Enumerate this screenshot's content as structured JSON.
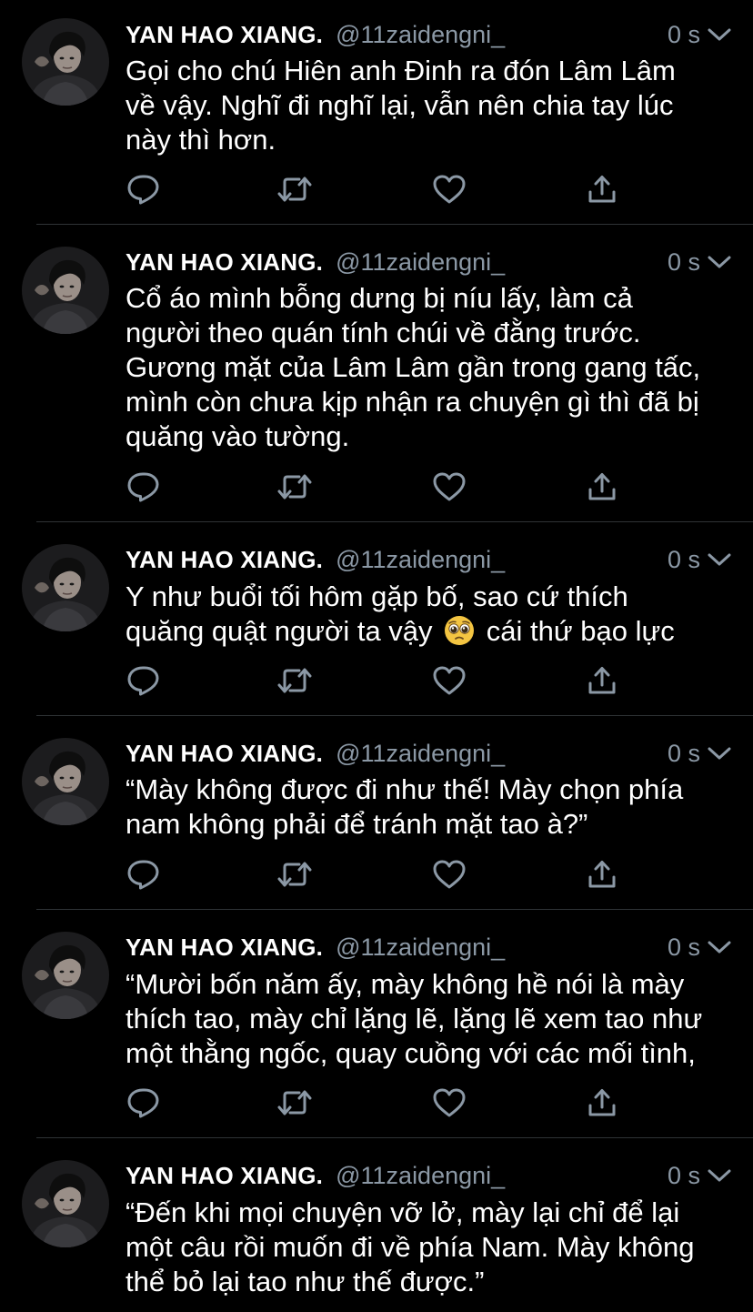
{
  "tweets": [
    {
      "author_name": "YAN HAO XIANG.",
      "handle": "@11zaidengni_",
      "time": "0 s",
      "text": "Gọi cho chú Hiên anh Đinh ra đón Lâm Lâm\nvề vậy. Nghĩ đi nghĩ lại, vẫn nên chia tay lúc\nnày thì hơn."
    },
    {
      "author_name": "YAN HAO XIANG.",
      "handle": "@11zaidengni_",
      "time": "0 s",
      "text": "Cổ áo mình bỗng dưng bị níu lấy, làm cả\nngười theo quán tính chúi về đằng trước.\nGương mặt của Lâm Lâm gần trong gang tấc,\nmình còn chưa kịp nhận ra chuyện gì thì đã bị\nquăng vào tường."
    },
    {
      "author_name": "YAN HAO XIANG.",
      "handle": "@11zaidengni_",
      "time": "0 s",
      "text_before_emoji": "Y như buổi tối hôm gặp bố, sao cứ thích\nquăng quật người ta vậy ",
      "emoji": "pleading-face",
      "text_after_emoji": " cái thứ bạo lực"
    },
    {
      "author_name": "YAN HAO XIANG.",
      "handle": "@11zaidengni_",
      "time": "0 s",
      "text": "“Mày không được đi như thế! Mày chọn phía\nnam không phải để tránh mặt tao à?”"
    },
    {
      "author_name": "YAN HAO XIANG.",
      "handle": "@11zaidengni_",
      "time": "0 s",
      "text": "“Mười bốn năm ấy, mày không hề nói là mày\nthích tao, mày chỉ lặng lẽ, lặng lẽ xem tao như\nmột thằng ngốc, quay cuồng với các mối tình,"
    },
    {
      "author_name": "YAN HAO XIANG.",
      "handle": "@11zaidengni_",
      "time": "0 s",
      "text": "“Đến khi mọi chuyện vỡ lở, mày lại chỉ để lại\nmột câu rồi muốn đi về phía Nam. Mày không\nthể bỏ lại tao như thế được.”"
    }
  ],
  "icons": {
    "reply": "reply-icon",
    "retweet": "retweet-icon",
    "like": "heart-icon",
    "share": "share-icon",
    "caret": "chevron-down-icon"
  },
  "colors": {
    "background": "#000000",
    "text": "#ffffff",
    "secondary": "#8b98a5",
    "divider": "#2f3336"
  }
}
